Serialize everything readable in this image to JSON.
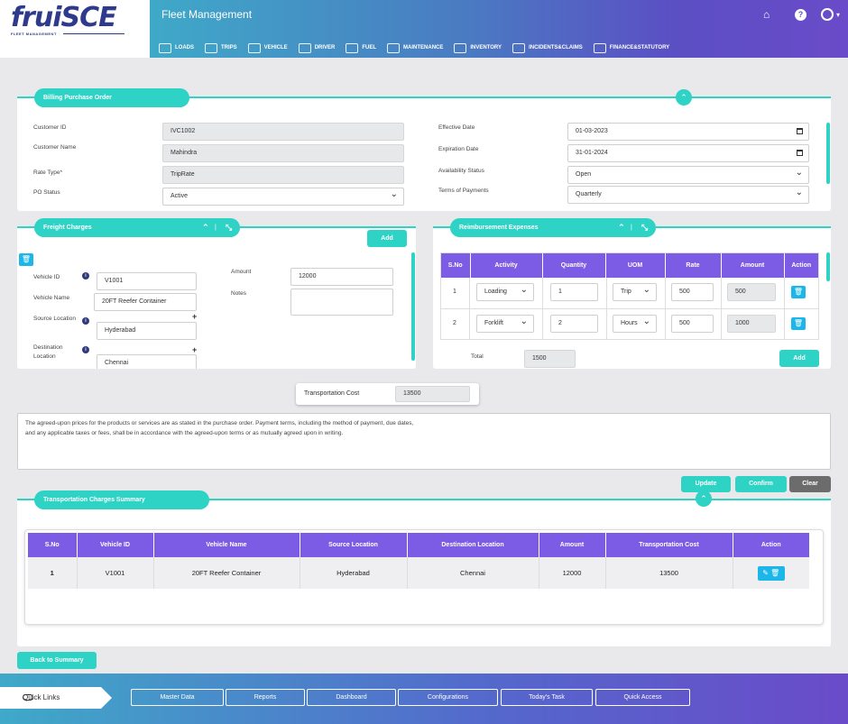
{
  "header": {
    "logo_main": "fruiSCE",
    "logo_sub": "FLEET MANAGEMENT",
    "title": "Fleet Management",
    "nav": [
      "LOADS",
      "TRIPS",
      "VEHICLE",
      "DRIVER",
      "FUEL",
      "MAINTENANCE",
      "INVENTORY",
      "INCIDENTS&CLAIMS",
      "FINANCE&STATUTORY"
    ]
  },
  "billing": {
    "title": "Billing Purchase Order",
    "customer_id_label": "Customer ID",
    "customer_id": "IVC1002",
    "customer_name_label": "Customer Name",
    "customer_name": "Mahindra",
    "rate_type_label": "Rate Type*",
    "rate_type": "TripRate",
    "po_status_label": "PO Status",
    "po_status": "Active",
    "effective_date_label": "Effective Date",
    "effective_date": "01-03-2023",
    "expiration_date_label": "Expiration Date",
    "expiration_date": "31-01-2024",
    "availability_label": "Availability Status",
    "availability": "Open",
    "terms_label": "Terms of Payments",
    "terms": "Quarterly"
  },
  "freight": {
    "title": "Freight Charges",
    "add_label": "Add",
    "vehicle_id_label": "Vehicle ID",
    "vehicle_id": "V1001",
    "vehicle_name_label": "Vehicle Name",
    "vehicle_name": "20FT Reefer Container",
    "source_label": "Source Location",
    "source": "Hyderabad",
    "destination_label": "Destination Location",
    "destination": "Chennai",
    "amount_label": "Amount",
    "amount": "12000",
    "notes_label": "Notes"
  },
  "reimbursement": {
    "title": "Reimbursement Expenses",
    "columns": [
      "S.No",
      "Activity",
      "Quantity",
      "UOM",
      "Rate",
      "Amount",
      "Action"
    ],
    "rows": [
      {
        "sno": "1",
        "activity": "Loading",
        "quantity": "1",
        "uom": "Trip",
        "rate": "500",
        "amount": "500"
      },
      {
        "sno": "2",
        "activity": "Forklift",
        "quantity": "2",
        "uom": "Hours",
        "rate": "500",
        "amount": "1000"
      }
    ],
    "total_label": "Total",
    "total": "1500",
    "add_label": "Add"
  },
  "transport_cost": {
    "label": "Transportation Cost",
    "value": "13500"
  },
  "terms_text_1": "The agreed-upon prices for the products or services are as stated in the purchase order. Payment terms, including the method of payment, due dates,",
  "terms_text_2": "and any applicable taxes or fees, shall be in accordance with the agreed-upon terms or as mutually agreed upon in writing.",
  "actions": {
    "update": "Update",
    "confirm": "Confirm",
    "clear": "Clear"
  },
  "summary": {
    "title": "Transportation Charges Summary",
    "columns": [
      "S.No",
      "Vehicle ID",
      "Vehicle Name",
      "Source Location",
      "Destination Location",
      "Amount",
      "Transportation Cost",
      "Action"
    ],
    "row": {
      "sno": "1",
      "vehicle_id": "V1001",
      "vehicle_name": "20FT Reefer Container",
      "source": "Hyderabad",
      "destination": "Chennai",
      "amount": "12000",
      "cost": "13500"
    }
  },
  "back_label": "Back to Summary",
  "footer": {
    "quick_links": "Quick Links",
    "buttons": [
      "Master Data",
      "Reports",
      "Dashboard",
      "Configurations",
      "Today's Task",
      "Quick Access"
    ]
  },
  "colors": {
    "teal": "#2ed3c6",
    "purple": "#7c5ce4",
    "navy": "#2e3a8c"
  }
}
